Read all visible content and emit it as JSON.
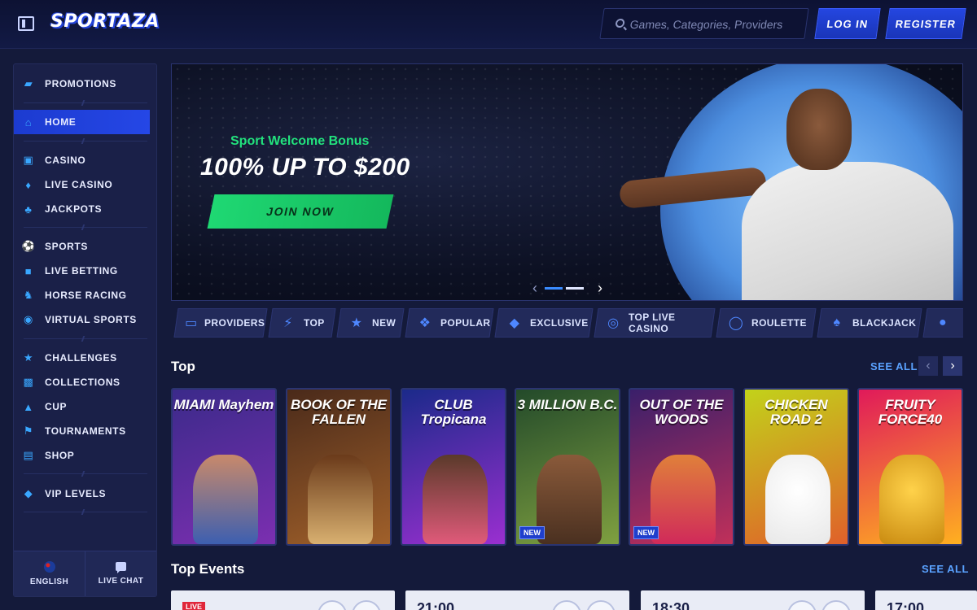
{
  "header": {
    "logo_text": "SPORTAZA",
    "search_placeholder": "Games, Categories, Providers",
    "login_label": "LOG IN",
    "register_label": "REGISTER"
  },
  "sidebar": {
    "items": [
      {
        "label": "PROMOTIONS",
        "icon": "gift-icon"
      },
      {
        "label": "HOME",
        "icon": "home-icon"
      },
      {
        "label": "CASINO",
        "icon": "slot-machine-icon"
      },
      {
        "label": "LIVE CASINO",
        "icon": "card-icon"
      },
      {
        "label": "JACKPOTS",
        "icon": "clover-icon"
      },
      {
        "label": "SPORTS",
        "icon": "soccer-ball-icon"
      },
      {
        "label": "LIVE BETTING",
        "icon": "live-icon"
      },
      {
        "label": "HORSE RACING",
        "icon": "horse-icon"
      },
      {
        "label": "VIRTUAL SPORTS",
        "icon": "virtual-icon"
      },
      {
        "label": "CHALLENGES",
        "icon": "medal-icon"
      },
      {
        "label": "COLLECTIONS",
        "icon": "collection-icon"
      },
      {
        "label": "CUP",
        "icon": "trophy-icon"
      },
      {
        "label": "TOURNAMENTS",
        "icon": "flag-icon"
      },
      {
        "label": "SHOP",
        "icon": "shop-icon"
      },
      {
        "label": "VIP LEVELS",
        "icon": "diamond-icon"
      }
    ],
    "active": "HOME",
    "language_label": "ENGLISH",
    "live_chat_label": "LIVE CHAT"
  },
  "banner": {
    "subtitle": "Sport Welcome Bonus",
    "title": "100% UP TO $200",
    "cta_label": "JOIN NOW",
    "slide_count": 2,
    "active_slide": 1
  },
  "categories": [
    {
      "label": "PROVIDERS",
      "icon": "providers-icon"
    },
    {
      "label": "TOP",
      "icon": "lightning-icon"
    },
    {
      "label": "NEW",
      "icon": "star-icon"
    },
    {
      "label": "POPULAR",
      "icon": "flame-icon"
    },
    {
      "label": "EXCLUSIVE",
      "icon": "diamond-icon"
    },
    {
      "label": "TOP LIVE CASINO",
      "icon": "chips-icon"
    },
    {
      "label": "ROULETTE",
      "icon": "roulette-icon"
    },
    {
      "label": "BLACKJACK",
      "icon": "cards-icon"
    }
  ],
  "top_section": {
    "title": "Top",
    "see_all_label": "SEE ALL",
    "games": [
      {
        "title": "MIAMI Mayhem",
        "badge": "",
        "colors": [
          "#3b2a8a",
          "#7b2fb0"
        ]
      },
      {
        "title": "BOOK OF THE FALLEN",
        "badge": "",
        "colors": [
          "#4a2a1a",
          "#a0602a"
        ]
      },
      {
        "title": "CLUB Tropicana",
        "badge": "",
        "colors": [
          "#1b2a8a",
          "#9a2fd0"
        ]
      },
      {
        "title": "3 MILLION B.C.",
        "badge": "NEW",
        "colors": [
          "#234a2a",
          "#7fa040"
        ]
      },
      {
        "title": "OUT OF THE WOODS",
        "badge": "NEW",
        "colors": [
          "#3a1f6a",
          "#c0305a"
        ]
      },
      {
        "title": "CHICKEN ROAD 2",
        "badge": "",
        "colors": [
          "#c2d21a",
          "#e0602a"
        ]
      },
      {
        "title": "FRUITY FORCE40",
        "badge": "",
        "colors": [
          "#e01a5a",
          "#ffb020"
        ]
      }
    ]
  },
  "events_section": {
    "title": "Top Events",
    "see_all_label": "SEE ALL",
    "events": [
      {
        "badge": "LIVE",
        "time": ""
      },
      {
        "badge": "",
        "time": "21:00"
      },
      {
        "badge": "",
        "time": "18:30"
      },
      {
        "badge": "",
        "time": "17:00"
      }
    ]
  }
}
